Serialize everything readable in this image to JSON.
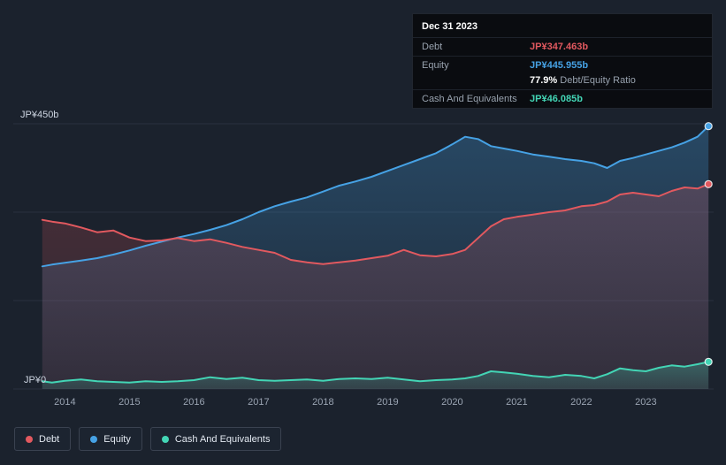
{
  "colors": {
    "background": "#1b222d",
    "debt": "#e2595f",
    "equity": "#46a2e5",
    "cash": "#43d5b5",
    "gridline": "#28303e"
  },
  "chart_data": {
    "type": "area",
    "title": "",
    "x_domain": [
      2013.2,
      2024.05
    ],
    "ylim": [
      0,
      450
    ],
    "grid": true,
    "legend_position": "bottom-left",
    "y_top_label": "JP¥450b",
    "y_bottom_label": "JP¥0",
    "gridline_values": [
      450,
      300,
      150,
      0
    ],
    "x_tick_labels": [
      "2014",
      "2015",
      "2016",
      "2017",
      "2018",
      "2019",
      "2020",
      "2021",
      "2022",
      "2023"
    ],
    "x": [
      2013.65,
      2013.8,
      2014.0,
      2014.25,
      2014.5,
      2014.75,
      2015.0,
      2015.25,
      2015.5,
      2015.75,
      2016.0,
      2016.25,
      2016.5,
      2016.75,
      2017.0,
      2017.25,
      2017.5,
      2017.75,
      2018.0,
      2018.25,
      2018.5,
      2018.75,
      2019.0,
      2019.25,
      2019.5,
      2019.75,
      2020.0,
      2020.2,
      2020.4,
      2020.6,
      2020.8,
      2021.0,
      2021.25,
      2021.5,
      2021.75,
      2022.0,
      2022.2,
      2022.4,
      2022.6,
      2022.8,
      2023.0,
      2023.2,
      2023.4,
      2023.6,
      2023.8,
      2023.97
    ],
    "series": [
      {
        "name": "Debt",
        "color": "#e2595f",
        "values": [
          287,
          284,
          281,
          274,
          266,
          269,
          257,
          251,
          252,
          256,
          251,
          254,
          248,
          241,
          236,
          231,
          219,
          215,
          212,
          215,
          218,
          222,
          226,
          236,
          227,
          225,
          229,
          236,
          256,
          276,
          288,
          292,
          296,
          300,
          303,
          310,
          312,
          318,
          330,
          333,
          330,
          327,
          336,
          342,
          340,
          347.5
        ]
      },
      {
        "name": "Equity",
        "color": "#46a2e5",
        "values": [
          208,
          211,
          214,
          218,
          222,
          228,
          235,
          243,
          250,
          257,
          263,
          270,
          278,
          288,
          300,
          310,
          318,
          325,
          335,
          345,
          352,
          360,
          370,
          380,
          390,
          400,
          415,
          428,
          424,
          412,
          408,
          404,
          398,
          394,
          390,
          387,
          383,
          375,
          387,
          392,
          398,
          404,
          410,
          418,
          428,
          446
        ]
      },
      {
        "name": "Cash And Equivalents",
        "color": "#43d5b5",
        "values": [
          13,
          11,
          14,
          16,
          13,
          12,
          11,
          13,
          12,
          13,
          15,
          20,
          17,
          19,
          15,
          14,
          15,
          16,
          14,
          17,
          18,
          17,
          19,
          16,
          13,
          15,
          16,
          18,
          22,
          30,
          28,
          26,
          22,
          20,
          24,
          22,
          18,
          25,
          35,
          32,
          30,
          36,
          40,
          38,
          42,
          46.1
        ]
      }
    ]
  },
  "tooltip": {
    "date": "Dec 31 2023",
    "rows": {
      "debt": {
        "label": "Debt",
        "value": "JP¥347.463b",
        "color": "#e2595f"
      },
      "equity": {
        "label": "Equity",
        "value": "JP¥445.955b",
        "color": "#46a2e5"
      },
      "ratio": {
        "value": "77.9%",
        "label": "Debt/Equity Ratio"
      },
      "cash": {
        "label": "Cash And Equivalents",
        "value": "JP¥46.085b",
        "color": "#43d5b5"
      }
    }
  },
  "legend": {
    "items": [
      {
        "label": "Debt",
        "color": "#e2595f"
      },
      {
        "label": "Equity",
        "color": "#46a2e5"
      },
      {
        "label": "Cash And Equivalents",
        "color": "#43d5b5"
      }
    ]
  }
}
